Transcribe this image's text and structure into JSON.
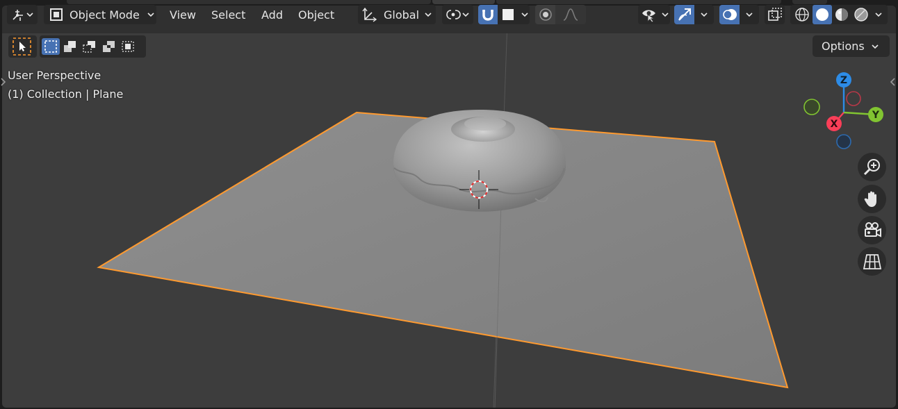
{
  "header": {
    "editor_type_icon": "3d-viewport-icon",
    "mode": {
      "label": "Object Mode",
      "icon": "object-mode-icon"
    },
    "menus": [
      "View",
      "Select",
      "Add",
      "Object"
    ],
    "transform_orientation": {
      "label": "Global",
      "icon": "transform-orientation-icon"
    },
    "pivot_icon": "pivot-point-icon",
    "snap_icon": "magnet-icon",
    "snap_target_icon": "snap-target-icon",
    "proportional_icon": "proportional-editing-icon",
    "falloff_icon": "falloff-curve-icon",
    "visibility_icon": "eye-selectability-icon",
    "gizmo_icon": "gizmo-icon",
    "overlay_icon": "overlays-icon",
    "xray_icon": "xray-icon",
    "shading_modes": [
      "wireframe",
      "solid",
      "material-preview",
      "rendered"
    ],
    "active_shading": "solid"
  },
  "toolbar": {
    "tool_icon": "select-box-icon",
    "selection_modes": [
      "set",
      "extend",
      "subtract",
      "invert",
      "intersect"
    ],
    "active_selection_mode": "set",
    "options_label": "Options"
  },
  "viewport": {
    "perspective_label": "User Perspective",
    "collection_label": "(1) Collection | Plane"
  },
  "gizmo": {
    "z_label": "Z",
    "x_label": "X",
    "y_label": "Y",
    "colors": {
      "x": "#fa3e58",
      "y": "#81c431",
      "z": "#2d8ce7"
    }
  },
  "nav": [
    "zoom-icon",
    "hand-pan-icon",
    "camera-view-icon",
    "orthographic-grid-icon"
  ],
  "colors": {
    "selection_outline": "#ff9a2f",
    "accent": "#4772b3",
    "viewport_bg": "#3d3d3d"
  }
}
